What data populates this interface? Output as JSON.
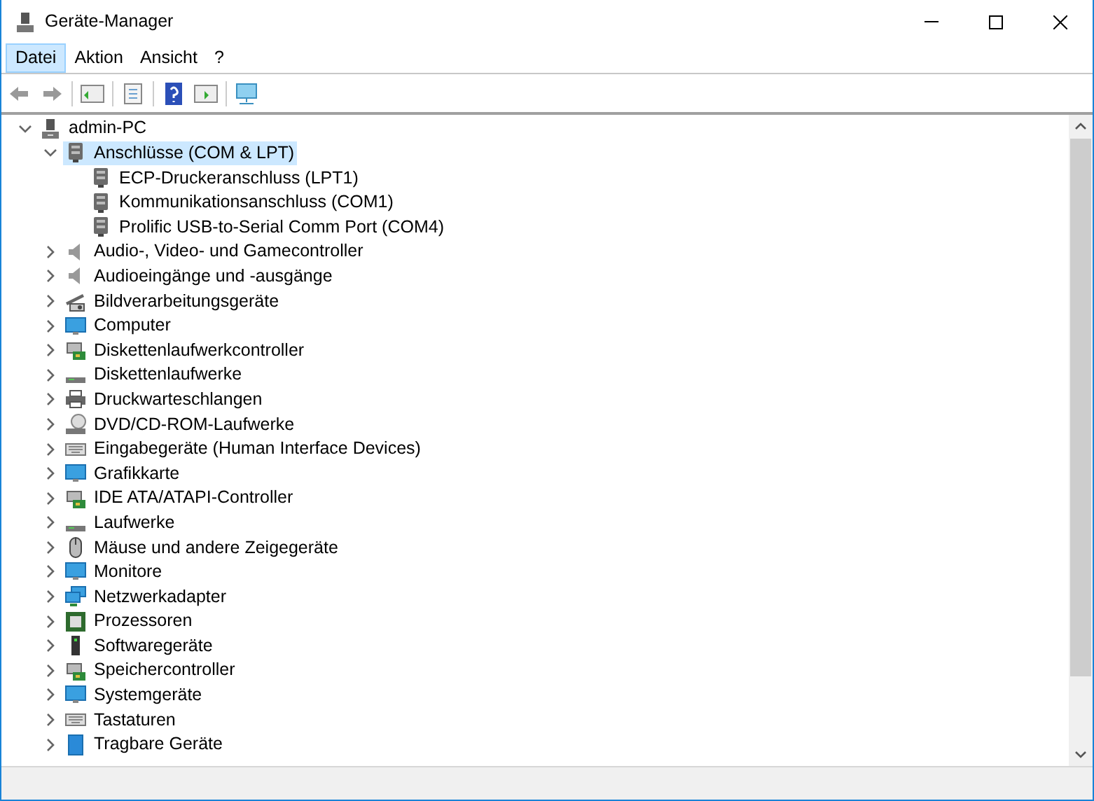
{
  "window": {
    "title": "Geräte-Manager"
  },
  "menu": [
    {
      "label": "Datei",
      "selected": true
    },
    {
      "label": "Aktion",
      "selected": false
    },
    {
      "label": "Ansicht",
      "selected": false
    },
    {
      "label": "?",
      "selected": false
    }
  ],
  "tree": [
    {
      "label": "admin-PC",
      "kind": "computer",
      "expanded": true,
      "selected": false,
      "children": [
        {
          "label": "Anschlüsse (COM & LPT)",
          "kind": "port",
          "expanded": true,
          "selected": true,
          "children": [
            {
              "label": "ECP-Druckeranschluss (LPT1)",
              "kind": "port",
              "selected": false
            },
            {
              "label": "Kommunikationsanschluss (COM1)",
              "kind": "port",
              "selected": false
            },
            {
              "label": "Prolific USB-to-Serial Comm Port (COM4)",
              "kind": "port",
              "selected": false
            }
          ]
        },
        {
          "label": "Audio-, Video- und Gamecontroller",
          "kind": "speaker",
          "expanded": false,
          "selected": false
        },
        {
          "label": "Audioeingänge und -ausgänge",
          "kind": "speaker",
          "expanded": false,
          "selected": false
        },
        {
          "label": "Bildverarbeitungsgeräte",
          "kind": "camera",
          "expanded": false,
          "selected": false
        },
        {
          "label": "Computer",
          "kind": "monitor",
          "expanded": false,
          "selected": false
        },
        {
          "label": "Diskettenlaufwerkcontroller",
          "kind": "card",
          "expanded": false,
          "selected": false
        },
        {
          "label": "Diskettenlaufwerke",
          "kind": "drive",
          "expanded": false,
          "selected": false
        },
        {
          "label": "Druckwarteschlangen",
          "kind": "printer",
          "expanded": false,
          "selected": false
        },
        {
          "label": "DVD/CD-ROM-Laufwerke",
          "kind": "disc",
          "expanded": false,
          "selected": false
        },
        {
          "label": "Eingabegeräte (Human Interface Devices)",
          "kind": "keyboard",
          "expanded": false,
          "selected": false
        },
        {
          "label": "Grafikkarte",
          "kind": "monitor",
          "expanded": false,
          "selected": false
        },
        {
          "label": "IDE ATA/ATAPI-Controller",
          "kind": "card",
          "expanded": false,
          "selected": false
        },
        {
          "label": "Laufwerke",
          "kind": "drive",
          "expanded": false,
          "selected": false
        },
        {
          "label": "Mäuse und andere Zeigegeräte",
          "kind": "mouse",
          "expanded": false,
          "selected": false
        },
        {
          "label": "Monitore",
          "kind": "monitor",
          "expanded": false,
          "selected": false
        },
        {
          "label": "Netzwerkadapter",
          "kind": "network",
          "expanded": false,
          "selected": false
        },
        {
          "label": "Prozessoren",
          "kind": "chip",
          "expanded": false,
          "selected": false
        },
        {
          "label": "Softwaregeräte",
          "kind": "tower",
          "expanded": false,
          "selected": false
        },
        {
          "label": "Speichercontroller",
          "kind": "card",
          "expanded": false,
          "selected": false
        },
        {
          "label": "Systemgeräte",
          "kind": "monitor",
          "expanded": false,
          "selected": false
        },
        {
          "label": "Tastaturen",
          "kind": "keyboard",
          "expanded": false,
          "selected": false
        },
        {
          "label": "Tragbare Geräte",
          "kind": "portable",
          "expanded": false,
          "selected": false
        }
      ]
    }
  ]
}
